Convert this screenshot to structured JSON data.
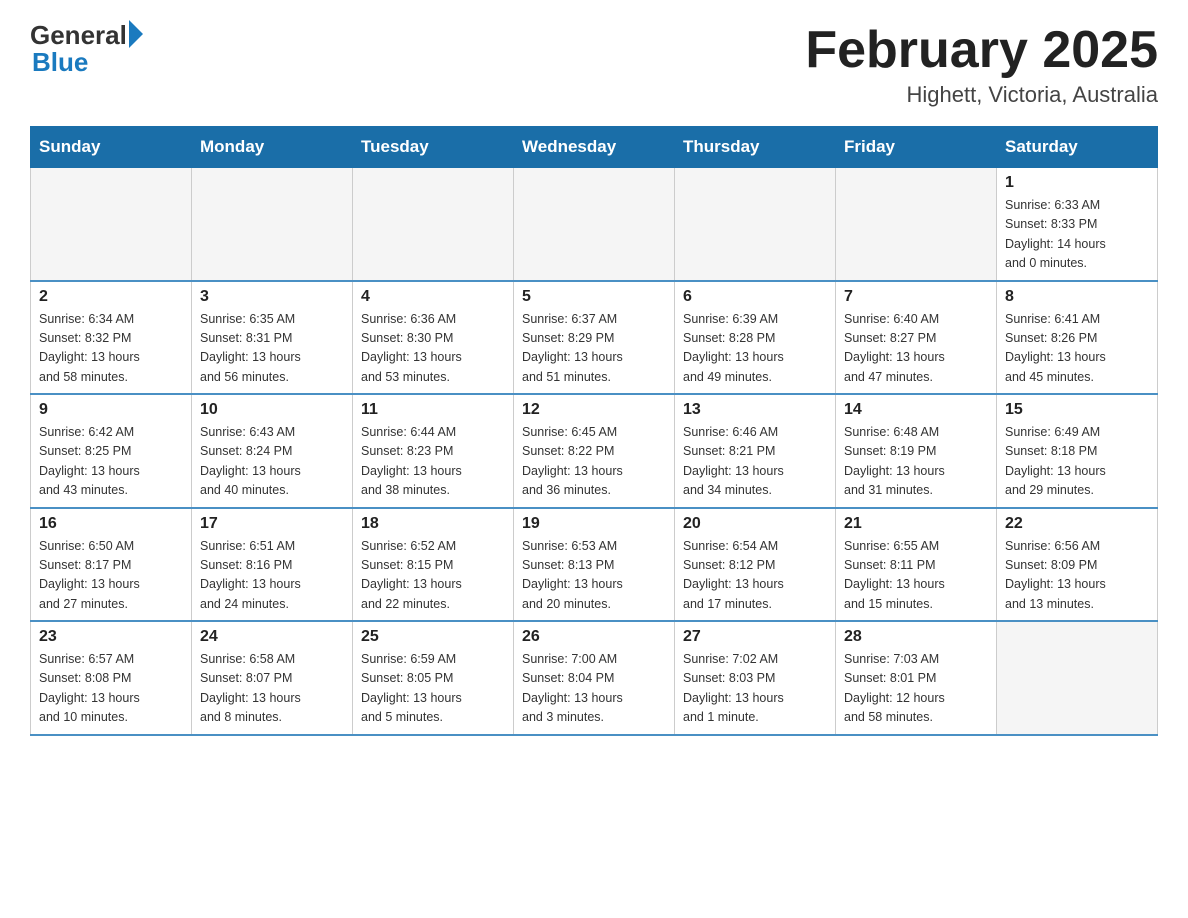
{
  "logo": {
    "general": "General",
    "blue": "Blue"
  },
  "title": "February 2025",
  "subtitle": "Highett, Victoria, Australia",
  "columns": [
    "Sunday",
    "Monday",
    "Tuesday",
    "Wednesday",
    "Thursday",
    "Friday",
    "Saturday"
  ],
  "weeks": [
    [
      {
        "day": "",
        "info": ""
      },
      {
        "day": "",
        "info": ""
      },
      {
        "day": "",
        "info": ""
      },
      {
        "day": "",
        "info": ""
      },
      {
        "day": "",
        "info": ""
      },
      {
        "day": "",
        "info": ""
      },
      {
        "day": "1",
        "info": "Sunrise: 6:33 AM\nSunset: 8:33 PM\nDaylight: 14 hours\nand 0 minutes."
      }
    ],
    [
      {
        "day": "2",
        "info": "Sunrise: 6:34 AM\nSunset: 8:32 PM\nDaylight: 13 hours\nand 58 minutes."
      },
      {
        "day": "3",
        "info": "Sunrise: 6:35 AM\nSunset: 8:31 PM\nDaylight: 13 hours\nand 56 minutes."
      },
      {
        "day": "4",
        "info": "Sunrise: 6:36 AM\nSunset: 8:30 PM\nDaylight: 13 hours\nand 53 minutes."
      },
      {
        "day": "5",
        "info": "Sunrise: 6:37 AM\nSunset: 8:29 PM\nDaylight: 13 hours\nand 51 minutes."
      },
      {
        "day": "6",
        "info": "Sunrise: 6:39 AM\nSunset: 8:28 PM\nDaylight: 13 hours\nand 49 minutes."
      },
      {
        "day": "7",
        "info": "Sunrise: 6:40 AM\nSunset: 8:27 PM\nDaylight: 13 hours\nand 47 minutes."
      },
      {
        "day": "8",
        "info": "Sunrise: 6:41 AM\nSunset: 8:26 PM\nDaylight: 13 hours\nand 45 minutes."
      }
    ],
    [
      {
        "day": "9",
        "info": "Sunrise: 6:42 AM\nSunset: 8:25 PM\nDaylight: 13 hours\nand 43 minutes."
      },
      {
        "day": "10",
        "info": "Sunrise: 6:43 AM\nSunset: 8:24 PM\nDaylight: 13 hours\nand 40 minutes."
      },
      {
        "day": "11",
        "info": "Sunrise: 6:44 AM\nSunset: 8:23 PM\nDaylight: 13 hours\nand 38 minutes."
      },
      {
        "day": "12",
        "info": "Sunrise: 6:45 AM\nSunset: 8:22 PM\nDaylight: 13 hours\nand 36 minutes."
      },
      {
        "day": "13",
        "info": "Sunrise: 6:46 AM\nSunset: 8:21 PM\nDaylight: 13 hours\nand 34 minutes."
      },
      {
        "day": "14",
        "info": "Sunrise: 6:48 AM\nSunset: 8:19 PM\nDaylight: 13 hours\nand 31 minutes."
      },
      {
        "day": "15",
        "info": "Sunrise: 6:49 AM\nSunset: 8:18 PM\nDaylight: 13 hours\nand 29 minutes."
      }
    ],
    [
      {
        "day": "16",
        "info": "Sunrise: 6:50 AM\nSunset: 8:17 PM\nDaylight: 13 hours\nand 27 minutes."
      },
      {
        "day": "17",
        "info": "Sunrise: 6:51 AM\nSunset: 8:16 PM\nDaylight: 13 hours\nand 24 minutes."
      },
      {
        "day": "18",
        "info": "Sunrise: 6:52 AM\nSunset: 8:15 PM\nDaylight: 13 hours\nand 22 minutes."
      },
      {
        "day": "19",
        "info": "Sunrise: 6:53 AM\nSunset: 8:13 PM\nDaylight: 13 hours\nand 20 minutes."
      },
      {
        "day": "20",
        "info": "Sunrise: 6:54 AM\nSunset: 8:12 PM\nDaylight: 13 hours\nand 17 minutes."
      },
      {
        "day": "21",
        "info": "Sunrise: 6:55 AM\nSunset: 8:11 PM\nDaylight: 13 hours\nand 15 minutes."
      },
      {
        "day": "22",
        "info": "Sunrise: 6:56 AM\nSunset: 8:09 PM\nDaylight: 13 hours\nand 13 minutes."
      }
    ],
    [
      {
        "day": "23",
        "info": "Sunrise: 6:57 AM\nSunset: 8:08 PM\nDaylight: 13 hours\nand 10 minutes."
      },
      {
        "day": "24",
        "info": "Sunrise: 6:58 AM\nSunset: 8:07 PM\nDaylight: 13 hours\nand 8 minutes."
      },
      {
        "day": "25",
        "info": "Sunrise: 6:59 AM\nSunset: 8:05 PM\nDaylight: 13 hours\nand 5 minutes."
      },
      {
        "day": "26",
        "info": "Sunrise: 7:00 AM\nSunset: 8:04 PM\nDaylight: 13 hours\nand 3 minutes."
      },
      {
        "day": "27",
        "info": "Sunrise: 7:02 AM\nSunset: 8:03 PM\nDaylight: 13 hours\nand 1 minute."
      },
      {
        "day": "28",
        "info": "Sunrise: 7:03 AM\nSunset: 8:01 PM\nDaylight: 12 hours\nand 58 minutes."
      },
      {
        "day": "",
        "info": ""
      }
    ]
  ]
}
